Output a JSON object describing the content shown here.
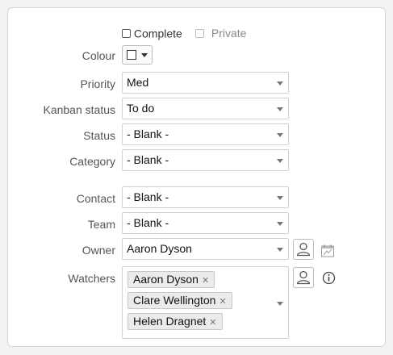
{
  "checkboxes": {
    "complete_label": "Complete",
    "private_label": "Private"
  },
  "fields": {
    "colour_label": "Colour",
    "priority_label": "Priority",
    "priority_value": "Med",
    "kanban_label": "Kanban status",
    "kanban_value": "To do",
    "status_label": "Status",
    "status_value": "- Blank -",
    "category_label": "Category",
    "category_value": "- Blank -",
    "contact_label": "Contact",
    "contact_value": "- Blank -",
    "team_label": "Team",
    "team_value": "- Blank -",
    "owner_label": "Owner",
    "owner_value": "Aaron Dyson",
    "watchers_label": "Watchers"
  },
  "watchers": [
    "Aaron Dyson",
    "Clare Wellington",
    "Helen Dragnet"
  ],
  "colors": {
    "border": "#d0d0d0",
    "label": "#555555",
    "chip_bg": "#ebebeb"
  }
}
